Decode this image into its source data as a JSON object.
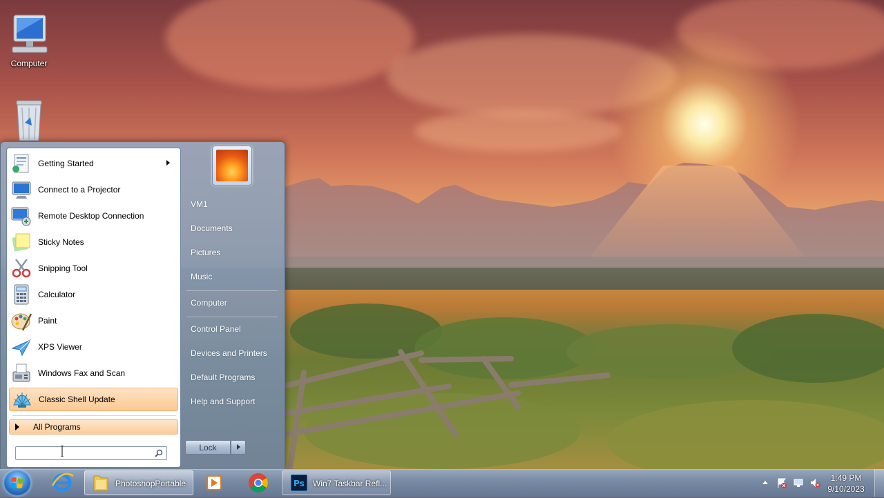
{
  "desktop": {
    "icons": [
      {
        "label": "Computer",
        "icon": "computer-icon"
      },
      {
        "label": "",
        "icon": "recycle-bin-icon"
      }
    ]
  },
  "start_menu": {
    "programs": [
      {
        "label": "Getting Started",
        "icon": "getting-started-icon",
        "has_submenu": true
      },
      {
        "label": "Connect to a Projector",
        "icon": "projector-icon"
      },
      {
        "label": "Remote Desktop Connection",
        "icon": "remote-desktop-icon"
      },
      {
        "label": "Sticky Notes",
        "icon": "sticky-notes-icon"
      },
      {
        "label": "Snipping Tool",
        "icon": "scissors-icon"
      },
      {
        "label": "Calculator",
        "icon": "calculator-icon"
      },
      {
        "label": "Paint",
        "icon": "paint-palette-icon"
      },
      {
        "label": "XPS Viewer",
        "icon": "xps-viewer-icon"
      },
      {
        "label": "Windows Fax and Scan",
        "icon": "fax-icon"
      },
      {
        "label": "Classic Shell Update",
        "icon": "shell-icon",
        "highlighted": true
      }
    ],
    "all_programs_label": "All Programs",
    "search": {
      "value": "",
      "placeholder": ""
    },
    "user_picture": "flower-avatar-icon",
    "right_links": [
      {
        "label": "VM1"
      },
      {
        "label": "Documents"
      },
      {
        "label": "Pictures"
      },
      {
        "label": "Music"
      },
      {
        "label": "Computer"
      },
      {
        "label": "Control Panel"
      },
      {
        "label": "Devices and Printers"
      },
      {
        "label": "Default Programs"
      },
      {
        "label": "Help and Support"
      }
    ],
    "lock_label": "Lock"
  },
  "taskbar": {
    "start": "windows-start-orb",
    "pinned": [
      {
        "name": "internet-explorer",
        "icon": "ie-icon"
      },
      {
        "name": "photoshop-portable",
        "icon": "folder-icon",
        "label": "PhotoshopPortable"
      },
      {
        "name": "media-player",
        "icon": "media-player-icon"
      },
      {
        "name": "chrome",
        "icon": "chrome-icon"
      },
      {
        "name": "win7-taskbar",
        "icon": "photoshop-icon",
        "label": "Win7 Taskbar Refl..."
      }
    ],
    "clock": {
      "time": "1:49 PM",
      "date": "9/10/2023"
    }
  },
  "colors": {
    "highlight": "#fbc994",
    "menu_glass": "#8ea3bd",
    "taskbar_glass": "#7c90ac"
  }
}
